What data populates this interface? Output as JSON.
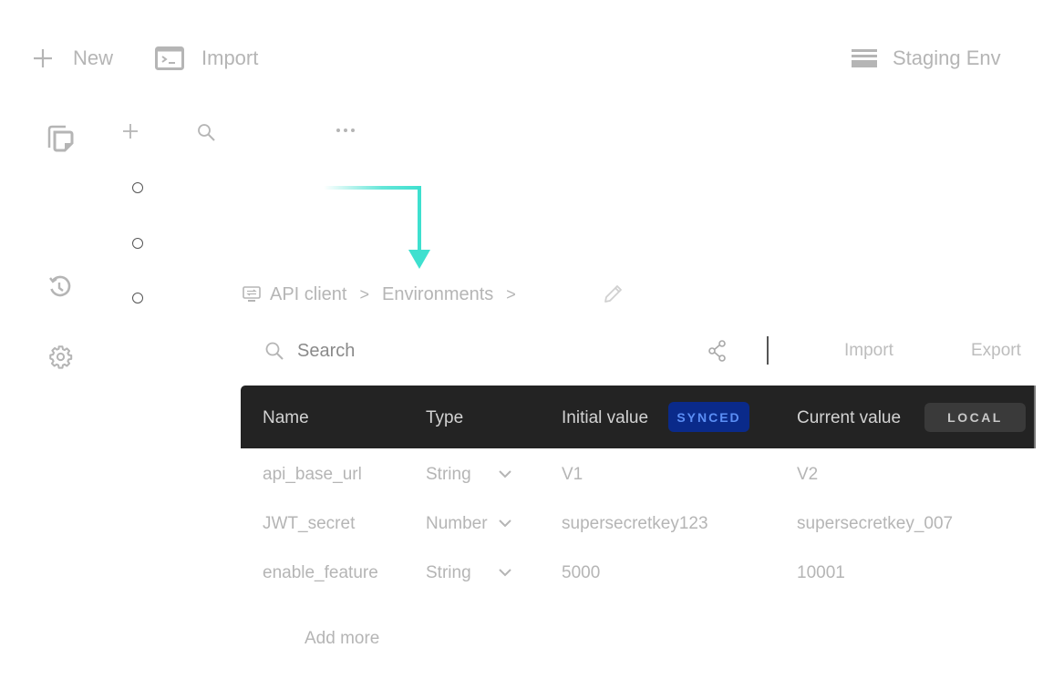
{
  "topbar": {
    "new_label": "New",
    "import_label": "Import",
    "environment_label": "Staging Env",
    "icons": {
      "new": "plus-icon",
      "import": "terminal-icon",
      "environment": "menu-stack-icon"
    }
  },
  "rail": {
    "icons": [
      "collections-icon",
      "history-icon",
      "settings-icon"
    ]
  },
  "sidebar": {
    "tool_icons": [
      "plus-icon",
      "search-icon",
      "more-icon"
    ],
    "radio_count": 3
  },
  "breadcrumb": {
    "items": [
      "API client",
      "Environments"
    ],
    "separator": ">",
    "icon": "api-client-icon",
    "edit_icon": "pencil-icon"
  },
  "toolbar": {
    "search_placeholder": "Search",
    "search_value": "",
    "share_icon": "share-icon",
    "import_label": "Import",
    "export_label": "Export"
  },
  "table": {
    "columns": [
      "Name",
      "Type",
      "Initial value",
      "Current value"
    ],
    "synced_badge": "SYNCED",
    "local_badge": "LOCAL",
    "rows": [
      {
        "name": "api_base_url",
        "type": "String",
        "initial": "V1",
        "current": "V2"
      },
      {
        "name": "JWT_secret",
        "type": "Number",
        "initial": "supersecretkey123",
        "current": "supersecretkey_007"
      },
      {
        "name": "enable_feature",
        "type": "String",
        "initial": "5000",
        "current": "10001"
      }
    ],
    "add_more_label": "Add more"
  },
  "colors": {
    "accent_arrow": "#3ee0cf",
    "header_bg": "#232323",
    "synced_bg": "#0a2a8a",
    "synced_text": "#5b8ef5",
    "local_bg": "#3a3a3a"
  }
}
